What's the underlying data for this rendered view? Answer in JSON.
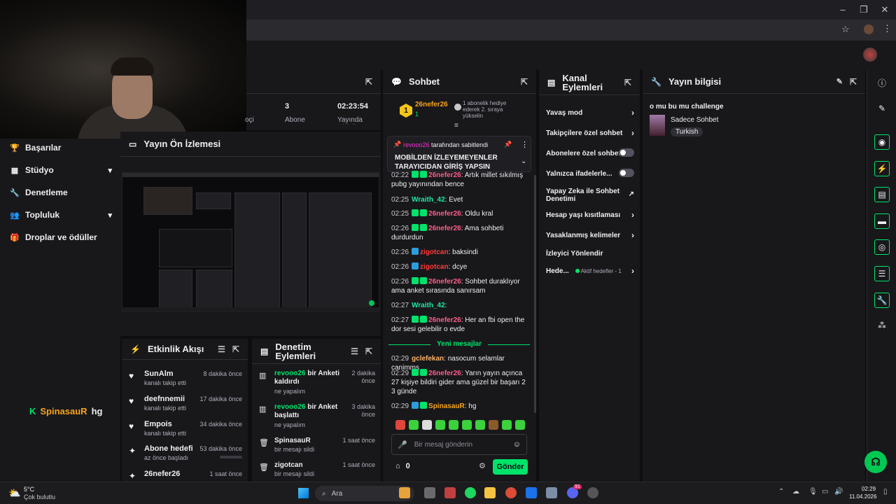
{
  "webcam": {
    "alt": "webcam"
  },
  "sidebar": {
    "items": [
      {
        "label": "Başarılar",
        "icon": "trophy-icon",
        "glyph": "🏆"
      },
      {
        "label": "Stüdyo",
        "icon": "studio-icon",
        "glyph": "▦",
        "chevron": "⌄"
      },
      {
        "label": "Denetleme",
        "icon": "wrench-icon",
        "glyph": "🔧"
      },
      {
        "label": "Topluluk",
        "icon": "people-icon",
        "glyph": "👥",
        "chevron": "⌄"
      },
      {
        "label": "Droplar ve ödüller",
        "icon": "gift-icon",
        "glyph": "🎁"
      }
    ]
  },
  "brand": {
    "logo": "K",
    "name": "SpinasauR",
    "suffix": "hg"
  },
  "stats": {
    "values": [
      {
        "value": "",
        "label": "oçi"
      },
      {
        "value": "3",
        "label": "Abone Sayısı"
      },
      {
        "value": "02:23:54",
        "label": "Yayında Olduğu"
      }
    ]
  },
  "preview": {
    "title": "Yayın Ön İzlemesi"
  },
  "activity": {
    "title": "Etkinlik Akışı",
    "items": [
      {
        "who": "SunAlm",
        "what": "kanalı takip etti",
        "when": "8 dakika önce"
      },
      {
        "who": "deefnnemii",
        "what": "kanalı takip etti",
        "when": "17 dakika önce"
      },
      {
        "who": "Empois",
        "what": "kanalı takip etti",
        "when": "34 dakika önce"
      },
      {
        "who": "Abone hedefi",
        "what": "az önce başladı",
        "when": "53 dakika önce"
      },
      {
        "who": "26nefer26",
        "what": "",
        "when": "1 saat önce"
      }
    ]
  },
  "moderation": {
    "title": "Denetim Eylemleri",
    "items": [
      {
        "user": "revooo26",
        "action": " bir Anketi kaldırdı",
        "sub": "ne yapalım",
        "when": "2 dakika önce"
      },
      {
        "user": "revooo26",
        "action": " bir Anket başlattı",
        "sub": "ne yapalım",
        "when": "3 dakika önce"
      },
      {
        "user": "",
        "action": "SpinasauR",
        "sub": "bir mesajı sildi",
        "when": "1 saat önce"
      },
      {
        "user": "",
        "action": "zigotcan",
        "sub": "bir mesajı sildi",
        "when": "1 saat önce"
      }
    ]
  },
  "chat": {
    "title": "Sohbet",
    "top_user": "26nefer26",
    "top_user_count": "1",
    "top_rank": "1",
    "top_gift_text": "1 abonelik hediye ederek 2. sıraya yükselin",
    "pinned_by_user": "revooo26",
    "pinned_by_text": " tarafından sabitlendi",
    "pinned_text": "MOBİLDEN İZLEYEMEYENLER TARAYICIDAN GİRİŞ YAPSIN",
    "messages": [
      {
        "time": "02:22",
        "user": "26nefer26",
        "color": "#ff5c8a",
        "badges": [
          "grn",
          "grn"
        ],
        "text": ": Artık millet sıkılmış pubg yayınından bence"
      },
      {
        "time": "02:25",
        "user": "Wraith_42",
        "color": "#1ee8a0",
        "badges": [],
        "text": ": Evet"
      },
      {
        "time": "02:25",
        "user": "26nefer26",
        "color": "#ff5c8a",
        "badges": [
          "grn",
          "grn"
        ],
        "text": ": Oldu kral"
      },
      {
        "time": "02:26",
        "user": "26nefer26",
        "color": "#ff5c8a",
        "badges": [
          "grn",
          "grn"
        ],
        "text": ": Ama sohbeti durdurdun"
      },
      {
        "time": "02:26",
        "user": "zigotcan",
        "color": "#ff3b3b",
        "badges": [
          "blu"
        ],
        "text": ": baksindi"
      },
      {
        "time": "02:26",
        "user": "zigotcan",
        "color": "#ff3b3b",
        "badges": [
          "blu"
        ],
        "text": ": dcye"
      },
      {
        "time": "02:26",
        "user": "26nefer26",
        "color": "#ff5c8a",
        "badges": [
          "grn",
          "grn"
        ],
        "text": ": Sohbet duraklıyor ama anket sırasında sanırsam"
      },
      {
        "time": "02:27",
        "user": "Wraith_42",
        "color": "#1ee8a0",
        "badges": [],
        "text": ":"
      },
      {
        "time": "02:27",
        "user": "26nefer26",
        "color": "#ff5c8a",
        "badges": [
          "grn",
          "grn"
        ],
        "text": ": Her an fbi open the dor sesi gelebilir o evde"
      }
    ],
    "new_label": "Yeni mesajlar",
    "new_messages": [
      {
        "time": "02:29",
        "user": "gclefekan",
        "color": "#ffb366",
        "badges": [],
        "text": ": nasocum selamlar canimms"
      },
      {
        "time": "02:29",
        "user": "26nefer26",
        "color": "#ff5c8a",
        "badges": [
          "grn",
          "grn"
        ],
        "text": ": Yarın yayın açınca 27 kişiye bildiri gider ama güzel bir başarı 2 3 günde"
      },
      {
        "time": "02:29",
        "user": "SpinasauR",
        "color": "#f7a41d",
        "badges": [
          "blu",
          "grn"
        ],
        "text": ": hg"
      }
    ],
    "input_placeholder": "Bir mesaj gönderin",
    "points": "0",
    "send_label": "Gönder"
  },
  "channel_actions": {
    "title": "Kanal Eylemleri",
    "items": [
      {
        "label": "Yavaş mod",
        "kind": "chevron"
      },
      {
        "label": "Takipçilere özel sohbet",
        "kind": "chevron"
      },
      {
        "label": "Abonelere özel sohbet",
        "kind": "toggle"
      },
      {
        "label": "Yalnızca ifadelerle...",
        "kind": "toggle"
      },
      {
        "label": "Yapay Zeka ile Sohbet Denetimi",
        "kind": "external"
      },
      {
        "label": "Hesap yaşı kısıtlaması",
        "kind": "chevron"
      },
      {
        "label": "Yasaklanmış kelimeler",
        "kind": "chevron"
      },
      {
        "label": "İzleyici Yönlendir",
        "kind": "none"
      },
      {
        "label": "Hede...",
        "kind": "chevron",
        "sub": "Aktif hedefler - 1"
      }
    ]
  },
  "stream_info": {
    "title": "Yayın bilgisi",
    "stream_title": "o mu bu mu challenge",
    "category": "Sadece Sohbet",
    "tag": "Turkish"
  },
  "taskbar": {
    "weather_temp": "5°C",
    "weather_desc": "Çok bulutlu",
    "search": "Ara",
    "time": "02:29",
    "date": "11.04.2026",
    "discord_badge": "91"
  },
  "colors": {
    "accent": "#00e36b",
    "bg": "#18181b",
    "page": "#0e0e10"
  }
}
